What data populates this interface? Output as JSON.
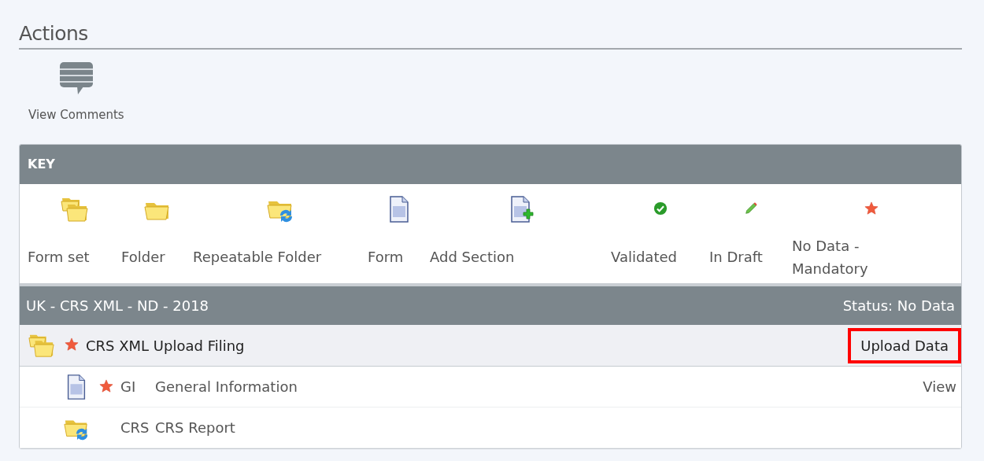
{
  "actions": {
    "title": "Actions",
    "buttons": [
      {
        "kind": "comments",
        "label": "View Comments"
      }
    ]
  },
  "key": {
    "title": "KEY",
    "items": [
      {
        "kind": "form_set",
        "label": "Form set"
      },
      {
        "kind": "folder",
        "label": "Folder"
      },
      {
        "kind": "repeatable_folder",
        "label": "Repeatable Folder"
      },
      {
        "kind": "form",
        "label": "Form"
      },
      {
        "kind": "add_section",
        "label": "Add Section"
      },
      {
        "kind": "validated",
        "label": "Validated"
      },
      {
        "kind": "in_draft",
        "label": "In Draft"
      },
      {
        "kind": "mandatory",
        "label": "No Data - Mandatory"
      }
    ]
  },
  "filing": {
    "title": "UK - CRS XML - ND - 2018",
    "status": "Status: No Data",
    "rows": [
      {
        "kind": "form_set",
        "mandatory": true,
        "title": "CRS XML Upload Filing",
        "action": "Upload Data",
        "highlighted": true,
        "children": [
          {
            "kind": "form",
            "mandatory": true,
            "code": "GI",
            "title": "General Information",
            "action": "View"
          },
          {
            "kind": "repeatable_folder",
            "mandatory": false,
            "code": "CRS",
            "title": "CRS Report"
          }
        ]
      }
    ]
  }
}
